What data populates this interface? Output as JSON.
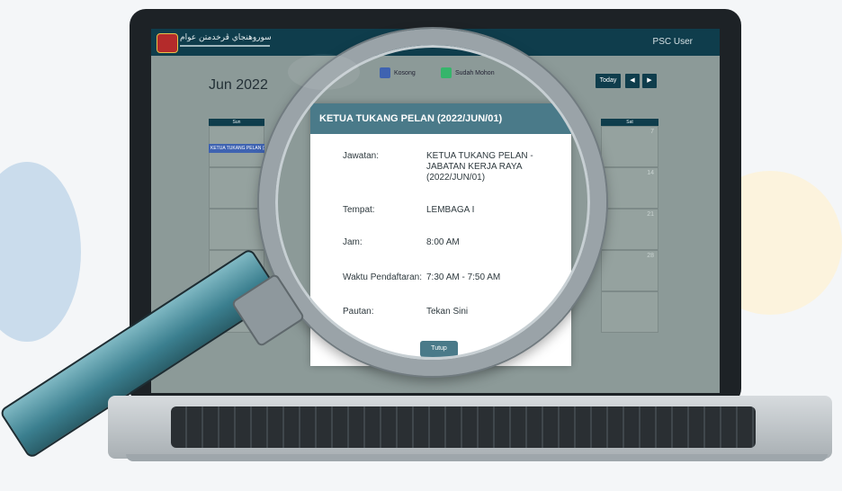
{
  "app": {
    "logo_text": "سوروهنجاي ڤرخدمتن عوام",
    "user_label": "PSC User"
  },
  "calendar": {
    "month_label": "Jun 2022",
    "legend": [
      {
        "label": "Kosong",
        "color": "#3f63b1"
      },
      {
        "label": "Sudah Mohon",
        "color": "#36b56b"
      }
    ],
    "today_label": "Today",
    "prev_icon": "◀",
    "next_icon": "▶",
    "weekday_sun": "Sun",
    "weekday_sat": "Sat",
    "event_chip": "KETUA TUKANG PELAN (2022/JUN/01)",
    "days": [
      "7",
      "14",
      "21",
      "28"
    ]
  },
  "dialog": {
    "title": "KETUA TUKANG PELAN (2022/JUN/01)",
    "fields": [
      {
        "label": "Jawatan:",
        "value": "KETUA TUKANG PELAN - JABATAN KERJA RAYA (2022/JUN/01)"
      },
      {
        "label": "Tempat:",
        "value": "LEMBAGA I"
      },
      {
        "label": "Jam:",
        "value": "8:00 AM"
      },
      {
        "label": "Waktu Pendaftaran:",
        "value": "7:30 AM - 7:50 AM"
      },
      {
        "label": "Pautan:",
        "value": "Tekan Sini"
      }
    ],
    "close_label": "Tutup"
  }
}
